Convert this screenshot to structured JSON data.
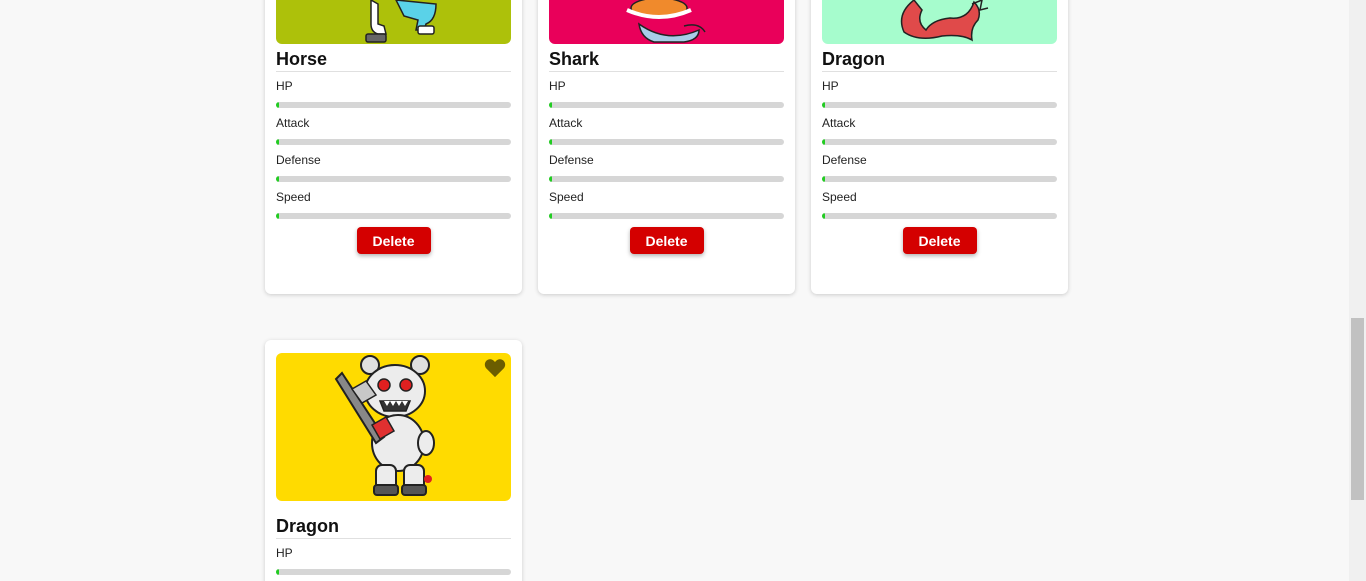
{
  "cards": [
    {
      "name": "Horse",
      "image_bg": "#adc10a",
      "stats": [
        {
          "label": "HP",
          "value": 0.01
        },
        {
          "label": "Attack",
          "value": 0.01
        },
        {
          "label": "Defense",
          "value": 0.01
        },
        {
          "label": "Speed",
          "value": 0.01
        }
      ],
      "delete_label": "Delete"
    },
    {
      "name": "Shark",
      "image_bg": "#e9005a",
      "stats": [
        {
          "label": "HP",
          "value": 0.01
        },
        {
          "label": "Attack",
          "value": 0.01
        },
        {
          "label": "Defense",
          "value": 0.01
        },
        {
          "label": "Speed",
          "value": 0.01
        }
      ],
      "delete_label": "Delete"
    },
    {
      "name": "Dragon",
      "image_bg": "#a6fccd",
      "stats": [
        {
          "label": "HP",
          "value": 0.01
        },
        {
          "label": "Attack",
          "value": 0.01
        },
        {
          "label": "Defense",
          "value": 0.01
        },
        {
          "label": "Speed",
          "value": 0.01
        }
      ],
      "delete_label": "Delete"
    },
    {
      "name": "Dragon",
      "image_bg": "#ffdb00",
      "favorite_icon": "heart-icon",
      "stats": [
        {
          "label": "HP",
          "value": 0.01
        }
      ]
    }
  ],
  "colors": {
    "stat_fill": "#22cc22",
    "stat_track": "#d6d6d6",
    "delete_button": "#d40000",
    "heart": "#6b5d00"
  }
}
